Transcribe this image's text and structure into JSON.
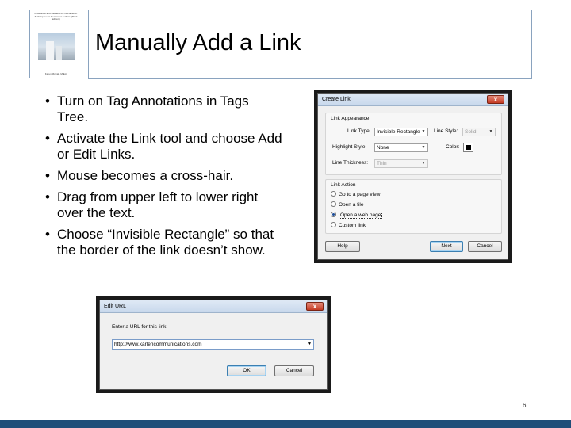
{
  "book": {
    "title": "Accessible and Usable PDF Documents: Techniques for Document Authors (Third Edition)",
    "author": "Karen McCall, M.Ed."
  },
  "slide": {
    "title": "Manually Add a Link",
    "bullets": [
      "Turn on Tag Annotations in Tags Tree.",
      "Activate the Link tool and choose Add or Edit Links.",
      "Mouse becomes a cross-hair.",
      "Drag from upper left to lower right over the text.",
      "Choose “Invisible Rectangle” so that the border of the link doesn’t show."
    ],
    "page_number": "6"
  },
  "create_link": {
    "title": "Create Link",
    "close": "x",
    "appearance": {
      "group_label": "Link Appearance",
      "link_type_label": "Link Type:",
      "link_type_value": "Invisible Rectangle",
      "line_style_label": "Line Style:",
      "line_style_value": "Solid",
      "highlight_label": "Highlight Style:",
      "highlight_value": "None",
      "color_label": "Color:",
      "color_value": "#000000",
      "thickness_label": "Line Thickness:",
      "thickness_value": "Thin"
    },
    "action": {
      "group_label": "Link Action",
      "options": [
        {
          "label": "Go to a page view",
          "selected": false
        },
        {
          "label": "Open a file",
          "selected": false
        },
        {
          "label": "Open a web page",
          "selected": true
        },
        {
          "label": "Custom link",
          "selected": false
        }
      ]
    },
    "help_label": "Help",
    "next_label": "Next",
    "cancel_label": "Cancel"
  },
  "edit_url": {
    "title": "Edit URL",
    "close": "x",
    "prompt": "Enter a URL for this link:",
    "url_value": "http://www.karlencommunications.com",
    "ok_label": "OK",
    "cancel_label": "Cancel"
  }
}
